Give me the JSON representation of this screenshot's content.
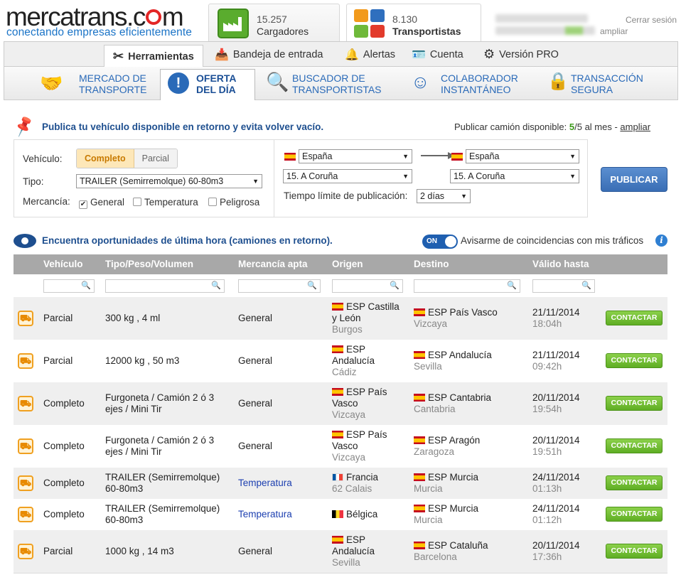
{
  "header": {
    "logo": "mercatrans.com",
    "logo_left": "mercatrans.c",
    "logo_right": "m",
    "tagline": "conectando empresas eficientemente",
    "cargadores": {
      "count": "15.257",
      "label": "Cargadores"
    },
    "transportistas": {
      "count": "8.130",
      "label": "Transportistas"
    },
    "signout": "Cerrar sesión",
    "ampliar": "ampliar"
  },
  "main_nav": [
    {
      "label": "Herramientas",
      "icon": "tools-icon"
    },
    {
      "label": "Bandeja de entrada",
      "icon": "inbox-icon"
    },
    {
      "label": "Alertas",
      "icon": "bell-icon"
    },
    {
      "label": "Cuenta",
      "icon": "id-card-icon"
    },
    {
      "label": "Versión PRO",
      "icon": "gear-icon"
    }
  ],
  "sub_nav": [
    {
      "line1": "Mercado de",
      "line2": "Transporte",
      "icon": "handshake-icon"
    },
    {
      "line1": "Oferta",
      "line2": "del día",
      "icon": "alert-icon"
    },
    {
      "line1": "Buscador de",
      "line2": "transportistas",
      "icon": "search-icon"
    },
    {
      "line1": "Colaborador",
      "line2": "instantáneo",
      "icon": "smile-icon"
    },
    {
      "line1": "Transacción",
      "line2": "segura",
      "icon": "lock-icon"
    }
  ],
  "publish": {
    "title": "Publica tu vehículo disponible en retorno y evita volver vacío.",
    "quota_prefix": "Publicar camión disponible: ",
    "quota_used": "5",
    "quota_rest": "/5 al mes - ",
    "quota_link": "ampliar",
    "vehicle_label": "Vehículo:",
    "vehicle_options": [
      "Completo",
      "Parcial"
    ],
    "type_label": "Tipo:",
    "type_value": "TRAILER (Semirremolque) 60-80m3",
    "goods_label": "Mercancía:",
    "goods": [
      {
        "label": "General",
        "checked": true
      },
      {
        "label": "Temperatura",
        "checked": false
      },
      {
        "label": "Peligrosa",
        "checked": false
      }
    ],
    "origin_country": "España",
    "origin_region": "15. A Coruña",
    "dest_country": "España",
    "dest_region": "15. A Coruña",
    "time_label": "Tiempo límite de publicación:",
    "time_value": "2 días",
    "button": "PUBLICAR"
  },
  "search": {
    "title": "Encuentra oportunidades de última hora (camiones en retorno).",
    "toggle": "ON",
    "notify": "Avisarme de coincidencias con mis tráficos",
    "info": "i"
  },
  "table": {
    "headers": [
      "Vehículo",
      "Tipo/Peso/Volumen",
      "Mercancía apta",
      "Origen",
      "Destino",
      "Válido hasta"
    ],
    "contact_label": "CONTACTAR",
    "rows": [
      {
        "vehicle": "Parcial",
        "type": "300 kg ,  4 ml",
        "goods": "General",
        "origin": "ESP Castilla y León",
        "origin_flag": "es",
        "origin_city": "Burgos",
        "dest": "ESP País Vasco",
        "dest_city": "Vizcaya",
        "date": "21/11/2014",
        "time": "18:04h"
      },
      {
        "vehicle": "Parcial",
        "type": "12000 kg ,  50 m3",
        "goods": "General",
        "origin": "ESP Andalucía",
        "origin_flag": "es",
        "origin_city": "Cádiz",
        "dest": "ESP Andalucía",
        "dest_city": "Sevilla",
        "date": "21/11/2014",
        "time": "09:42h"
      },
      {
        "vehicle": "Completo",
        "type": "Furgoneta / Camión 2 ó 3 ejes / Mini Tir",
        "goods": "General",
        "origin": "ESP País Vasco",
        "origin_flag": "es",
        "origin_city": "Vizcaya",
        "dest": "ESP Cantabria",
        "dest_city": "Cantabria",
        "date": "20/11/2014",
        "time": "19:54h"
      },
      {
        "vehicle": "Completo",
        "type": "Furgoneta / Camión 2 ó 3 ejes / Mini Tir",
        "goods": "General",
        "origin": "ESP País Vasco",
        "origin_flag": "es",
        "origin_city": "Vizcaya",
        "dest": "ESP Aragón",
        "dest_city": "Zaragoza",
        "date": "20/11/2014",
        "time": "19:51h"
      },
      {
        "vehicle": "Completo",
        "type": "TRAILER (Semirremolque) 60-80m3",
        "goods": "Temperatura",
        "origin": "Francia",
        "origin_flag": "fr",
        "origin_city": "62 Calais",
        "dest": "ESP Murcia",
        "dest_city": "Murcia",
        "date": "24/11/2014",
        "time": "01:13h"
      },
      {
        "vehicle": "Completo",
        "type": "TRAILER (Semirremolque) 60-80m3",
        "goods": "Temperatura",
        "origin": "Bélgica",
        "origin_flag": "be",
        "origin_city": "",
        "dest": "ESP Murcia",
        "dest_city": "Murcia",
        "date": "24/11/2014",
        "time": "01:12h"
      },
      {
        "vehicle": "Parcial",
        "type": "1000 kg ,  14 m3",
        "goods": "General",
        "origin": "ESP Andalucía",
        "origin_flag": "es",
        "origin_city": "Sevilla",
        "dest": "ESP Cataluña",
        "dest_city": "Barcelona",
        "date": "20/11/2014",
        "time": "17:36h"
      }
    ]
  }
}
